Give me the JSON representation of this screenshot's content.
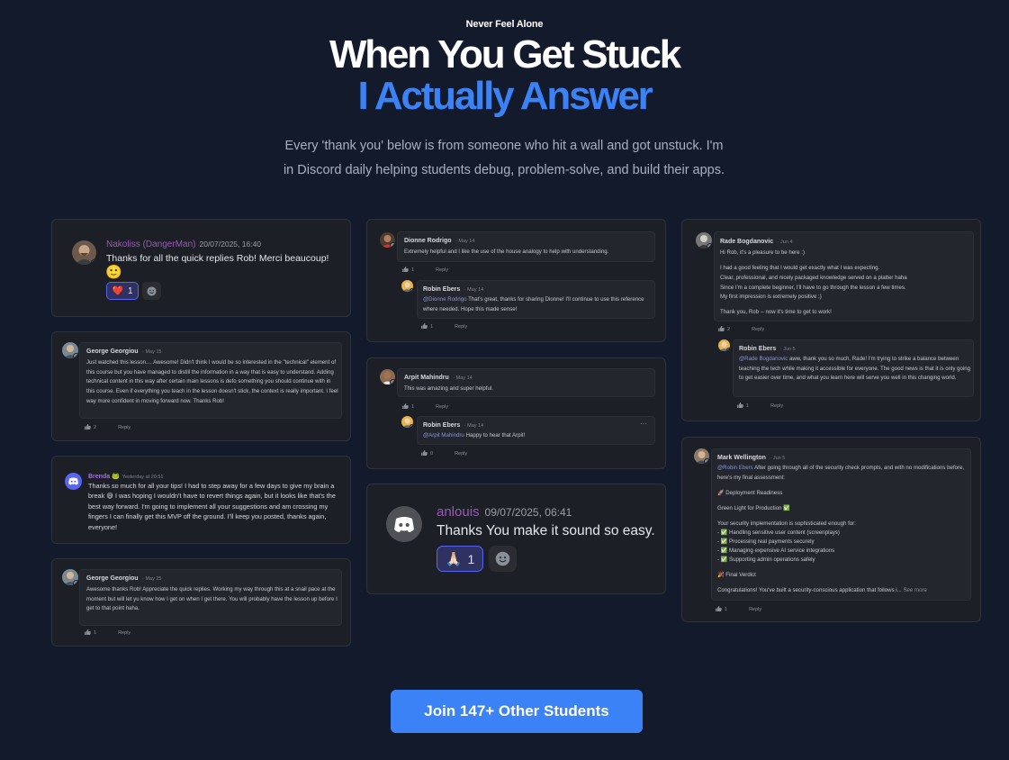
{
  "hero": {
    "eyebrow": "Never Feel Alone",
    "title_line1": "When You Get Stuck",
    "title_line2": "I Actually Answer",
    "subtitle": "Every 'thank you' below is from someone who hit a wall and got unstuck. I'm in Discord daily helping students debug, problem-solve, and build their apps."
  },
  "col1": {
    "c1": {
      "name": "Nakoliss (DangerMan)",
      "date": "20/07/2025, 16:40",
      "text": "Thanks for all the quick replies Rob! Merci beaucoup!",
      "emoji": "🙂",
      "reaction_emoji": "❤️",
      "reaction_count": "1"
    },
    "c2": {
      "name": "George Georgiou",
      "date": "May 15",
      "text": "Just watched this lesson.... Awesome! Didn't think I would be so interested in the \"technical\" element of this course but you have managed to distill the information in a way that is easy to understand. Adding technical content in this way after certain main lessons is defo something you should continue with in this course. Even if everything you teach in the lesson doesn't stick, the context is really important. I feel way more confident in moving forward now. Thanks Rob!",
      "likes": "2",
      "reply": "Reply"
    },
    "c3": {
      "name": "Brenda",
      "name_emoji": "🐸",
      "date": "Yesterday at 20:51",
      "text_a": "Thanks so much for all your tips! I had to step away for a few days to give my brain a break",
      "text_emoji": "😅",
      "text_b": "I was hoping I wouldn't have to revert things again, but it looks like that's the best way forward. I'm going to implement all your suggestions and am crossing my fingers I can finally get this MVP off the ground. I'll keep you posted, thanks again, everyone!"
    },
    "c4": {
      "name": "George Georgiou",
      "date": "May 25",
      "text": "Awesome thanks Rob! Appreciate the quick replies. Working my way through this at a snail pace at the moment but will let yu know how I get on when I get there. You will probably have the lesson up before I get to that point haha.",
      "likes": "1",
      "reply": "Reply"
    }
  },
  "col2": {
    "c1": {
      "name": "Dionne Rodrigo",
      "date": "May 14",
      "text": "Extremely helpful and I like the use of the house analogy to help with understanding.",
      "likes": "1",
      "reply": "Reply",
      "reply_name": "Robin Ebers",
      "reply_date": "May 14",
      "reply_mention": "@Dionne Rodrigo",
      "reply_text": "That's great, thanks for sharing Dionne! I'll continue to use this reference where needed. Hope this made sense!",
      "reply_likes": "1",
      "reply_reply": "Reply"
    },
    "c2": {
      "name": "Arpit Mahindru",
      "date": "May 14",
      "text": "This was amazing and super helpful.",
      "likes": "1",
      "reply": "Reply",
      "reply_name": "Robin Ebers",
      "reply_date": "May 14",
      "reply_more": "···",
      "reply_mention": "@Arpit Mahindru",
      "reply_text": "Happy to hear that Arpit!",
      "reply_likes": "0",
      "reply_reply": "Reply"
    },
    "c3": {
      "name": "anlouis",
      "date": "09/07/2025, 06:41",
      "text": "Thanks You make it sound so easy.",
      "reaction_emoji": "🙏🏻",
      "reaction_count": "1"
    }
  },
  "col3": {
    "c1": {
      "name": "Rade Bogdanovic",
      "date": "Jun 4",
      "lines": [
        "Hi Rob, it's a pleasure to be here :)",
        "I had a good feeling that I would get exactly what I was expecting.",
        "Clear, professional, and nicely packaged knowledge served on a platter haha",
        "Since I'm a complete beginner, I'll have to go through the lesson a few times.",
        "My first impression is extremely positive ;)",
        "Thank you, Rob -- now it's time to get to work!"
      ],
      "likes": "2",
      "reply": "Reply",
      "reply_name": "Robin Ebers",
      "reply_date": "Jun 5",
      "reply_mention": "@Rade Bogdanovic",
      "reply_text": "aww, thank you so much, Rade! I'm trying to strike a balance between teaching the tech while making it accessible for everyone. The good news is that it is only going to get easier over time, and what you learn here will serve you well in this changing world.",
      "reply_likes": "1",
      "reply_reply": "Reply"
    },
    "c2": {
      "name": "Mark Wellington",
      "date": "Jun 5",
      "mention": "@Robin Ebers",
      "intro": "After going through all of the security check prompts, and with no modifications before, here's my final assessment:",
      "h1": "🚀 Deployment Readiness",
      "green": "Green Light for Production ✅",
      "para": "Your security implementation is sophisticated enough for:",
      "bullets": [
        "- ✅ Handling sensitive user content (screenplays)",
        "- ✅ Processing real payments securely",
        "- ✅ Managing expensive AI service integrations",
        "- ✅ Supporting admin operations safely"
      ],
      "h2": "🎉 Final Verdict",
      "closing": "Congratulations! You've built a security-conscious application that follows i...",
      "see_more": "See more",
      "likes": "1",
      "reply": "Reply"
    }
  },
  "cta": {
    "label": "Join 147+ Other Students"
  },
  "colors": {
    "accent": "#3b82f6",
    "background": "#131a2b",
    "card": "#1c1f26",
    "username_purple": "#9b59b6"
  }
}
